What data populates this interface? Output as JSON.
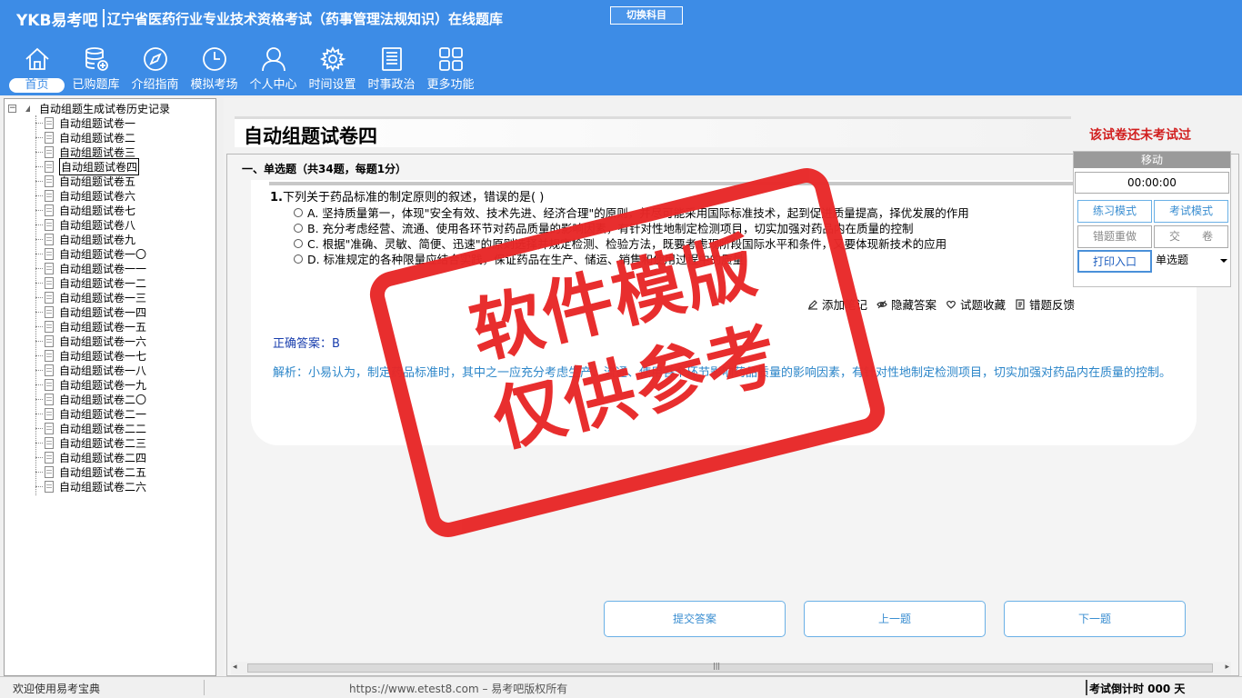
{
  "header": {
    "brand": "YKB易考吧",
    "title": "辽宁省医药行业专业技术资格考试（药事管理法规知识）在线题库",
    "switch_button": "切换科目"
  },
  "nav": [
    {
      "label": "首页",
      "icon": "home-icon"
    },
    {
      "label": "已购题库",
      "icon": "database-icon"
    },
    {
      "label": "介绍指南",
      "icon": "compass-icon"
    },
    {
      "label": "模拟考场",
      "icon": "clock-icon"
    },
    {
      "label": "个人中心",
      "icon": "user-icon"
    },
    {
      "label": "时间设置",
      "icon": "gear-icon"
    },
    {
      "label": "时事政治",
      "icon": "document-icon"
    },
    {
      "label": "更多功能",
      "icon": "grid-icon"
    }
  ],
  "tree": {
    "root": "自动组题生成试卷历史记录",
    "items": [
      "自动组题试卷一",
      "自动组题试卷二",
      "自动组题试卷三",
      "自动组题试卷四",
      "自动组题试卷五",
      "自动组题试卷六",
      "自动组题试卷七",
      "自动组题试卷八",
      "自动组题试卷九",
      "自动组题试卷一〇",
      "自动组题试卷一一",
      "自动组题试卷一二",
      "自动组题试卷一三",
      "自动组题试卷一四",
      "自动组题试卷一五",
      "自动组题试卷一六",
      "自动组题试卷一七",
      "自动组题试卷一八",
      "自动组题试卷一九",
      "自动组题试卷二〇",
      "自动组题试卷二一",
      "自动组题试卷二二",
      "自动组题试卷二三",
      "自动组题试卷二四",
      "自动组题试卷二五",
      "自动组题试卷二六"
    ],
    "selected_index": 3
  },
  "paper": {
    "title": "自动组题试卷四",
    "status": "该试卷还未考试过",
    "section": "一、单选题（共34题，每题1分）"
  },
  "question": {
    "number": "1.",
    "text": "下列关于药品标准的制定原则的叙述，错误的是(  )",
    "options": [
      "A. 坚持质量第一，体现\"安全有效、技术先进、经济合理\"的原则，并尽可能采用国际标准技术，起到促进质量提高，择优发展的作用",
      "B. 充分考虑经营、流通、使用各环节对药品质量的影响因素，有针对性地制定检测项目，切实加强对药品内在质量的控制",
      "C. 根据\"准确、灵敏、简便、迅速\"的原则选择并规定检测、检验方法，既要考虑现阶段国际水平和条件，又要体现新技术的应用",
      "D. 标准规定的各种限量应结合实践，保证药品在生产、储运、销售和使用过程中的质量"
    ],
    "answer": "正确答案：B",
    "analysis": "解析：小易认为，制定药品标准时，其中之一应充分考虑生产、流通、使用各个环节影响药品质量的影响因素，有针对性地制定检测项目，切实加强对药品内在质量的控制。"
  },
  "tools": [
    {
      "label": "添加笔记",
      "icon": "pencil-icon"
    },
    {
      "label": "隐藏答案",
      "icon": "eye-icon"
    },
    {
      "label": "试题收藏",
      "icon": "heart-icon"
    },
    {
      "label": "错题反馈",
      "icon": "feedback-icon"
    }
  ],
  "buttons": {
    "submit": "提交答案",
    "prev": "上一题",
    "next": "下一题"
  },
  "control": {
    "header": "移动",
    "timer": "00:00:00",
    "practice": "练习模式",
    "exam": "考试模式",
    "redo": "错题重做",
    "hand_in": "交　　卷",
    "print": "打印入口",
    "type_select": "单选题"
  },
  "watermark": {
    "line1": "软件模版",
    "line2": "仅供参考"
  },
  "status": {
    "welcome": "欢迎使用易考宝典",
    "copyright": "https://www.etest8.com – 易考吧版权所有",
    "countdown": "考试倒计时 000 天"
  },
  "colors": {
    "header_bg": "#3d8ce6",
    "accent_blue": "#3a8ed1",
    "warning_red": "#d11f1f",
    "watermark_red": "#e82828"
  }
}
